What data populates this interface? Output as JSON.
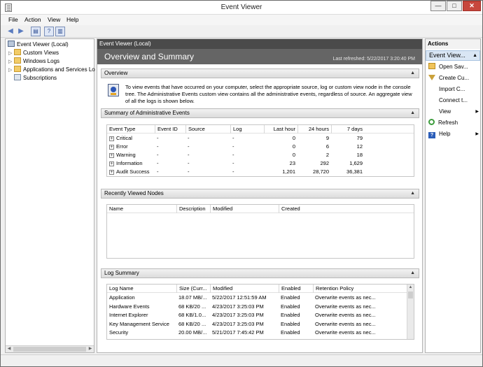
{
  "window": {
    "title": "Event Viewer"
  },
  "menu": [
    "File",
    "Action",
    "View",
    "Help"
  ],
  "toolbar": [
    {
      "icon": "back-arrow-icon",
      "glyph": "◀"
    },
    {
      "icon": "forward-arrow-icon",
      "glyph": "▶"
    },
    {
      "icon": "console-tree-icon",
      "glyph": "▤"
    },
    {
      "icon": "help-icon",
      "glyph": "?"
    },
    {
      "icon": "action-pane-icon",
      "glyph": "▥"
    }
  ],
  "tree": [
    {
      "label": "Event Viewer (Local)",
      "icon": "event-viewer-icon",
      "expandable": false,
      "indent": 0
    },
    {
      "label": "Custom Views",
      "icon": "folder-icon",
      "expandable": true,
      "indent": 1
    },
    {
      "label": "Windows Logs",
      "icon": "folder-icon",
      "expandable": true,
      "indent": 1
    },
    {
      "label": "Applications and Services Lo",
      "icon": "folder-icon",
      "expandable": true,
      "indent": 1
    },
    {
      "label": "Subscriptions",
      "icon": "subscriptions-icon",
      "expandable": false,
      "indent": 1
    }
  ],
  "center": {
    "bar": "Event Viewer (Local)",
    "heading": "Overview and Summary",
    "last_refreshed": "Last refreshed: 5/22/2017 3:20:40 PM",
    "overview": {
      "title": "Overview",
      "text": "To view events that have occurred on your computer, select the appropriate source, log or custom view node in the console tree. The Administrative Events custom view contains all the administrative events, regardless of source. An aggregate view of all the logs is shown below."
    },
    "summary": {
      "title": "Summary of Administrative Events",
      "columns": [
        "Event Type",
        "Event ID",
        "Source",
        "Log",
        "Last hour",
        "24 hours",
        "7 days"
      ],
      "rows": [
        [
          "Critical",
          "-",
          "-",
          "-",
          "0",
          "9",
          "79"
        ],
        [
          "Error",
          "-",
          "-",
          "-",
          "0",
          "6",
          "12"
        ],
        [
          "Warning",
          "-",
          "-",
          "-",
          "0",
          "2",
          "18"
        ],
        [
          "Information",
          "-",
          "-",
          "-",
          "23",
          "292",
          "1,629"
        ],
        [
          "Audit Success",
          "-",
          "-",
          "-",
          "1,201",
          "28,720",
          "36,381"
        ]
      ]
    },
    "recent": {
      "title": "Recently Viewed Nodes",
      "columns": [
        "Name",
        "Description",
        "Modified",
        "Created"
      ]
    },
    "logsummary": {
      "title": "Log Summary",
      "columns": [
        "Log Name",
        "Size (Curr...",
        "Modified",
        "Enabled",
        "Retention Policy"
      ],
      "rows": [
        [
          "Application",
          "18.07 MB/...",
          "5/22/2017 12:51:59 AM",
          "Enabled",
          "Overwrite events as nec..."
        ],
        [
          "Hardware Events",
          "68 KB/20 ...",
          "4/23/2017 3:25:03 PM",
          "Enabled",
          "Overwrite events as nec..."
        ],
        [
          "Internet Explorer",
          "68 KB/1.0...",
          "4/23/2017 3:25:03 PM",
          "Enabled",
          "Overwrite events as nec..."
        ],
        [
          "Key Management Service",
          "68 KB/20 ...",
          "4/23/2017 3:25:03 PM",
          "Enabled",
          "Overwrite events as nec..."
        ],
        [
          "Security",
          "20.00 MB/...",
          "5/21/2017 7:45:42 PM",
          "Enabled",
          "Overwrite events as nec..."
        ]
      ]
    }
  },
  "actions": {
    "title": "Actions",
    "subtitle": "Event View...",
    "items": [
      {
        "label": "Open Sav...",
        "icon": "open-saved-log-icon",
        "submenu": false
      },
      {
        "label": "Create Cu...",
        "icon": "filter-icon",
        "submenu": false
      },
      {
        "label": "Import C...",
        "icon": "",
        "submenu": false
      },
      {
        "label": "Connect t...",
        "icon": "",
        "submenu": false
      },
      {
        "label": "View",
        "icon": "",
        "submenu": true
      },
      {
        "label": "Refresh",
        "icon": "refresh-icon",
        "submenu": false
      },
      {
        "label": "Help",
        "icon": "help-icon",
        "submenu": true
      }
    ]
  }
}
